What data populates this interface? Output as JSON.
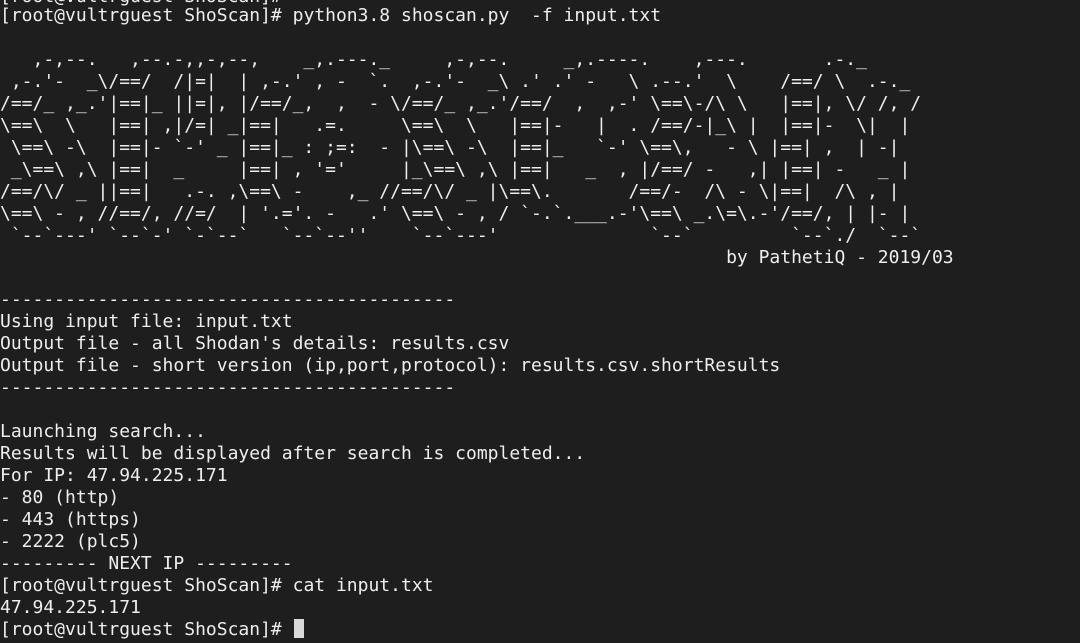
{
  "terminal": {
    "prompt": "[root@vultrguest ShoScan]# ",
    "command1": "python3.8 shoscan.py  -f input.txt",
    "banner": [
      "   ,-,--.   ,--.-,,-,--,    _,.---._     ,-,--.     _,.----.    ,---.       .-._",
      " ,-.'-  _\\/==/  /|=|  | ,-.' , -  `.  ,-.'-  _\\ .' .' -   \\ .--.'  \\    /==/ \\  .-._",
      "/==/_ ,_.'|==|_ ||=|, |/==/_,  ,  - \\/==/_ ,_.'/==/  ,  ,-' \\==\\-/\\ \\   |==|, \\/ /, /",
      "\\==\\  \\   |==| ,|/=| _|==|   .=.     \\==\\  \\   |==|-   |  . /==/-|_\\ |  |==|-  \\|  |",
      " \\==\\ -\\  |==|- `-' _ |==|_ : ;=:  - |\\==\\ -\\  |==|_   `-' \\==\\,   - \\ |==| ,  | -|",
      " _\\==\\ ,\\ |==|  _     |==| , '='     |_\\==\\ ,\\ |==|   _  , |/==/ -   ,| |==| -   _ |",
      "/==/\\/ _ ||==|   .-. ,\\==\\ -    ,_ //==/\\/ _ |\\==\\.       /==/-  /\\ - \\|==|  /\\ , |",
      "\\==\\ - , //==/, //=/  | '.='. -   .' \\==\\ - , / `-.`.___.-'\\==\\ _.\\=\\.-'/==/, | |- |",
      " `--`---' `--`-' `-`--`   `--`--''    `--`---'              `--`         `--`./  `--`"
    ],
    "byline": "                                                                   by PathetiQ - 2019/03",
    "separator": "------------------------------------------",
    "input_file_line": "Using input file: input.txt",
    "output_all_line": "Output file - all Shodan's details: results.csv",
    "output_short_line": "Output file - short version (ip,port,protocol): results.csv.shortResults",
    "launching": "Launching search...",
    "results_note": "Results will be displayed after search is completed...",
    "for_ip": "For IP: 47.94.225.171",
    "ports": [
      "- 80 (http)",
      "- 443 (https)",
      "- 2222 (plc5)"
    ],
    "next_ip": "--------- NEXT IP ---------",
    "command2": "cat input.txt",
    "cat_output": "47.94.225.171"
  }
}
